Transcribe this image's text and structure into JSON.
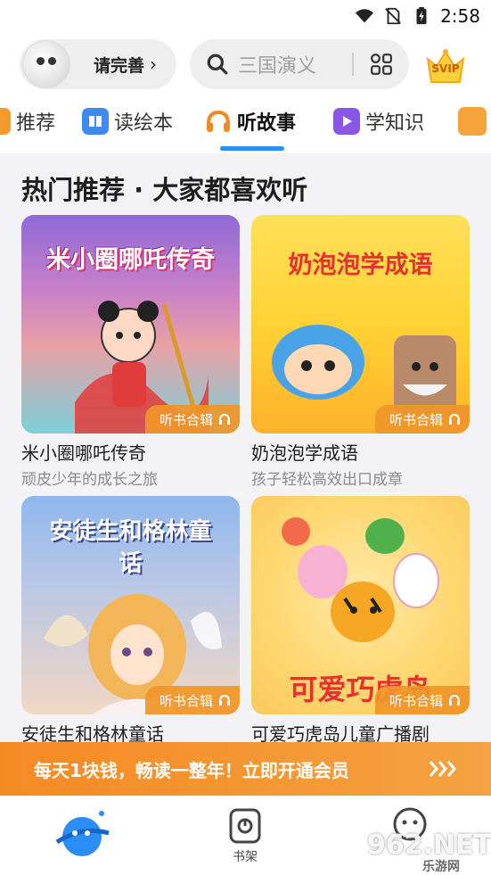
{
  "status_bar": {
    "time": "2:58"
  },
  "header": {
    "profile_prompt": "请完善",
    "search_placeholder": "三国演义"
  },
  "svip_label": "SVIP",
  "tabs": [
    {
      "label": "推荐"
    },
    {
      "label": "读绘本"
    },
    {
      "label": "听故事",
      "active": true
    },
    {
      "label": "学知识"
    }
  ],
  "section": {
    "title": "热门推荐 · 大家都喜欢听"
  },
  "cards": [
    {
      "cover_text": "米小圈哪吒传奇",
      "badge": "听书合辑",
      "title": "米小圈哪吒传奇",
      "subtitle": "顽皮少年的成长之旅"
    },
    {
      "cover_text": "奶泡泡学成语",
      "badge": "听书合辑",
      "title": "奶泡泡学成语",
      "subtitle": "孩子轻松高效出口成章"
    },
    {
      "cover_text": "安徒生和格林童话",
      "badge": "听书合辑",
      "title": "安徒生和格林童话",
      "subtitle": ""
    },
    {
      "cover_text": "可爱巧虎岛",
      "badge": "听书合辑",
      "title": "可爱巧虎岛儿童广播剧",
      "subtitle": ""
    }
  ],
  "promo": {
    "text": "每天1块钱，畅读一整年！立即开通会员"
  },
  "bottom_nav": {
    "shelf_label": "书架"
  },
  "watermark": {
    "brand": "962.NET",
    "sub": "乐游网"
  },
  "colors": {
    "accent": "#2b8df6",
    "promo": "#f58a23",
    "badge": "#f0962b"
  }
}
